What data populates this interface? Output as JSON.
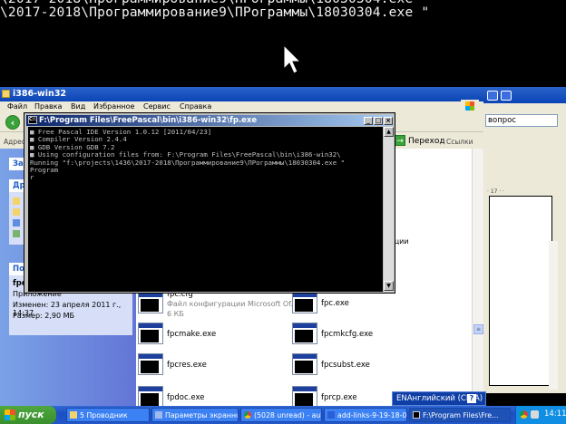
{
  "background_console": {
    "line1": "\\2017-2018\\Программирование9\\ПРограммы\\18030304.exe \""
  },
  "explorer": {
    "title": "i386-win32",
    "menu": [
      "Файл",
      "Правка",
      "Вид",
      "Избранное",
      "Сервис",
      "Справка"
    ],
    "address_label": "Адрес",
    "go_label": "Переход",
    "links_label": "Ссылки",
    "task_pane": {
      "section1_head": "За",
      "section2_head": "Др",
      "details_head": "По"
    },
    "details": {
      "name": "fpc",
      "type": "Приложение",
      "modified": "Изменен: 23 апреля 2011 г., 14:37",
      "size": "Размер: 2,90 МБ"
    },
    "files": [
      {
        "name": "fpc.cfg",
        "sub": "Файл конфигурации Microsoft Of...",
        "sub2": "6 КБ"
      },
      {
        "name": "fpc.exe"
      },
      {
        "name": "fpcmake.exe"
      },
      {
        "name": "fpcmkcfg.exe"
      },
      {
        "name": "fpcres.exe"
      },
      {
        "name": "fpcsubst.exe"
      },
      {
        "name": "fpdoc.exe"
      },
      {
        "name": "fprcp.exe"
      }
    ],
    "partial_text": "урации"
  },
  "right_window": {
    "search_text": "вопрос",
    "ruler_text": "· 17 · ·"
  },
  "fp_console": {
    "title": "F:\\Program Files\\FreePascal\\bin\\i386-win32\\fp.exe",
    "icon_label": "C:\\",
    "lines": [
      "■ Free Pascal IDE Version 1.0.12 [2011/04/23]",
      "■ Compiler Version 2.4.4",
      "■ GDB Version GDB 7.2",
      "■ Using configuration files from: F:\\Program Files\\FreePascal\\bin\\i386-win32\\",
      "Running \"f:\\projects\\1436\\2017-2018\\Программирование9\\ПРограммы\\18030304.exe \"",
      "Program",
      "r"
    ]
  },
  "language_bar": {
    "label": "ENАнглийский (США)",
    "help": "?"
  },
  "taskbar": {
    "start_label": "пуск",
    "buttons": [
      "5 Проводник",
      "Параметры экранно...",
      "(5028 unread) - auto...",
      "add-links-9-19-18-03...",
      "F:\\Program Files\\Fre..."
    ],
    "clock": "14:11"
  }
}
